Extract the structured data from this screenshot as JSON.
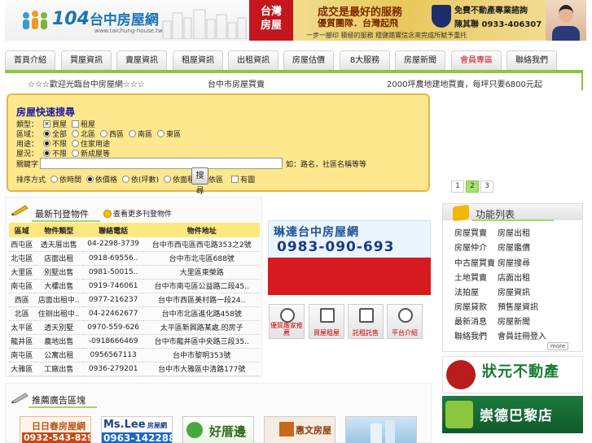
{
  "header": {
    "logo_number": "104",
    "logo_name": "台中房屋網",
    "logo_url": "www.taichung-house.tw",
    "banner": {
      "brand_line1": "台灣",
      "brand_line2": "房屋",
      "slogan1": "成交是最好的服務",
      "slogan2": "優質團隊．台灣起飛",
      "consult": "免費不動產專業諮詢",
      "phone": "0933-406307",
      "agent": "陳其聯",
      "tagline": "一步一腳印 積極的服務 穩健踏實信念來完成所賦予重托"
    }
  },
  "nav": {
    "tabs": [
      "首頁介紹",
      "買屋資訊",
      "賣屋資訊",
      "租屋資訊",
      "出租資訊",
      "房屋估價",
      "8大服務",
      "房屋新聞",
      "會員專區",
      "聯絡我們"
    ],
    "active_index": 8
  },
  "marquee": [
    "☆☆☆歡迎光臨台中房屋網☆☆☆",
    "台中市房屋買賣",
    "2000坪農地建地買賣，每坪只要6800元起"
  ],
  "search": {
    "title": "房屋快速搜尋",
    "row1_label": "類型：",
    "row1_options": [
      "買屋",
      "租屋"
    ],
    "row2_label": "區域：",
    "row2_options": [
      "全部",
      "北區",
      "西區",
      "南區",
      "東區"
    ],
    "row3_label": "用途：",
    "row3_options": [
      "不限",
      "住家用途"
    ],
    "row4_label": "屋況：",
    "row4_options": [
      "不限",
      "新成屋等"
    ],
    "keyword_label": "關鍵字",
    "keyword_value": "",
    "keyword_hint": "如：路名，社區名稱等等",
    "sort_label": "排序方式",
    "sort_options": [
      "依時間",
      "依價格",
      "依(坪數)",
      "依面積",
      "依區"
    ],
    "photo_only": "有圖",
    "button": "搜尋"
  },
  "pager": {
    "pages": [
      "1",
      "2",
      "3"
    ],
    "current": "2"
  },
  "listings": {
    "title": "最新刊登物件",
    "sublink": "查看更多刊登物件",
    "columns": [
      "區域",
      "物件類型",
      "聯絡電話",
      "物件地址"
    ],
    "rows": [
      [
        "西屯區",
        "透天厝出售",
        "04-2298-3739",
        "台中市西屯區西屯路353之2號"
      ],
      [
        "北屯區",
        "店面出租",
        "0918-69556..",
        "台中市北屯區688號"
      ],
      [
        "大里區",
        "別墅出售",
        "0981-50015..",
        "大里區東榮路"
      ],
      [
        "南屯區",
        "大樓出售",
        "0919-746061",
        "台中市南屯區公益路二段45.."
      ],
      [
        "西區",
        "店面出租中..",
        "0977-216237",
        "台中市西區美村路一段24.."
      ],
      [
        "北區",
        "住辦出租中..",
        "04-22462677",
        "台中市北區進化路458號"
      ],
      [
        "太平區",
        "透天別墅",
        "0970-559-626",
        "太平區新興路某處.的房子"
      ],
      [
        "龍井區",
        "農地出售",
        "-0918666469",
        "台中市龍井區中央路三段35.."
      ],
      [
        "南屯區",
        "公寓出租",
        "0956567113",
        "台中市黎明353號"
      ],
      [
        "大雅區",
        "工廠出售",
        "0936-279201",
        "台中市大雅區中清路177號"
      ]
    ]
  },
  "mid_ad": {
    "name": "琳達台中房屋網",
    "phone": "0983-090-693"
  },
  "func_icons": [
    "優質廠家推薦",
    "買屋租屋",
    "託租託售",
    "平台介紹"
  ],
  "functions": {
    "title": "功能列表",
    "items": [
      "房屋買賣",
      "房屋出租",
      "房屋仲介",
      "房屋鑑價",
      "中古屋買賣",
      "房屋搜尋",
      "土地買賣",
      "店面出租",
      "法拍屋",
      "房屋資訊",
      "房屋貸款",
      "預售屋資訊",
      "最新消息",
      "房屋新聞",
      "聯絡我們",
      "會員註冊登入"
    ],
    "more": "more"
  },
  "right_ads": [
    "狀元不動產",
    "崇德巴黎店"
  ],
  "recommend": {
    "title": "推薦廣告區塊",
    "logos": [
      {
        "name": "日日春房屋網",
        "phone": "0932-543-829"
      },
      {
        "name": "Ms.Lee",
        "suffix": "房屋網",
        "phone": "0963-142288"
      },
      {
        "name": "好厝邊"
      },
      {
        "name": "惠文房屋"
      },
      {
        "name": ""
      }
    ]
  },
  "colors": {
    "nav_green": "#8cc63f",
    "search_bg": "#fde88d",
    "table_head": "#fce87f",
    "red": "#d71920"
  }
}
